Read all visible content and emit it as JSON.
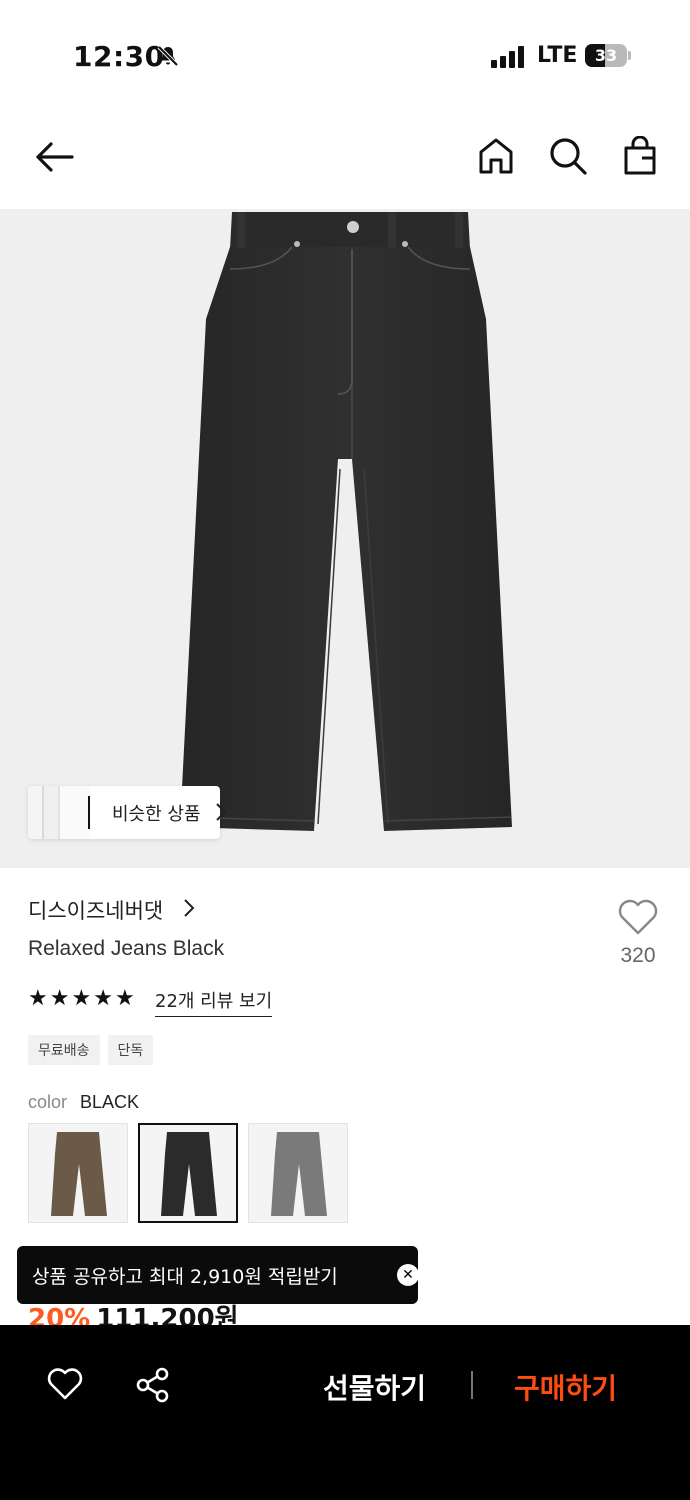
{
  "status_bar": {
    "time": "12:30",
    "network": "LTE",
    "battery": "33"
  },
  "nav": {
    "icons": [
      "back-arrow-icon",
      "home-icon",
      "search-icon",
      "shopping-bag-icon"
    ]
  },
  "similar_products": {
    "label": "비슷한 상품"
  },
  "product": {
    "brand": "디스이즈네버댓",
    "name": "Relaxed Jeans Black",
    "like_count": "320",
    "rating_stars": 5,
    "review_link": "22개 리뷰 보기",
    "badges": [
      "무료배송",
      "단독"
    ],
    "color_label": "color",
    "color_value": "BLACK",
    "color_options": [
      {
        "name": "brown",
        "hex": "#6b5a48"
      },
      {
        "name": "black",
        "hex": "#2b2b2b"
      },
      {
        "name": "grey",
        "hex": "#7a7a7a"
      }
    ],
    "discount": "20%",
    "price": "111,200원"
  },
  "toast": {
    "text": "상품 공유하고 최대 2,910원 적립받기"
  },
  "bottom_bar": {
    "gift_label": "선물하기",
    "buy_label": "구매하기",
    "buy_color": "#ff4d12"
  }
}
